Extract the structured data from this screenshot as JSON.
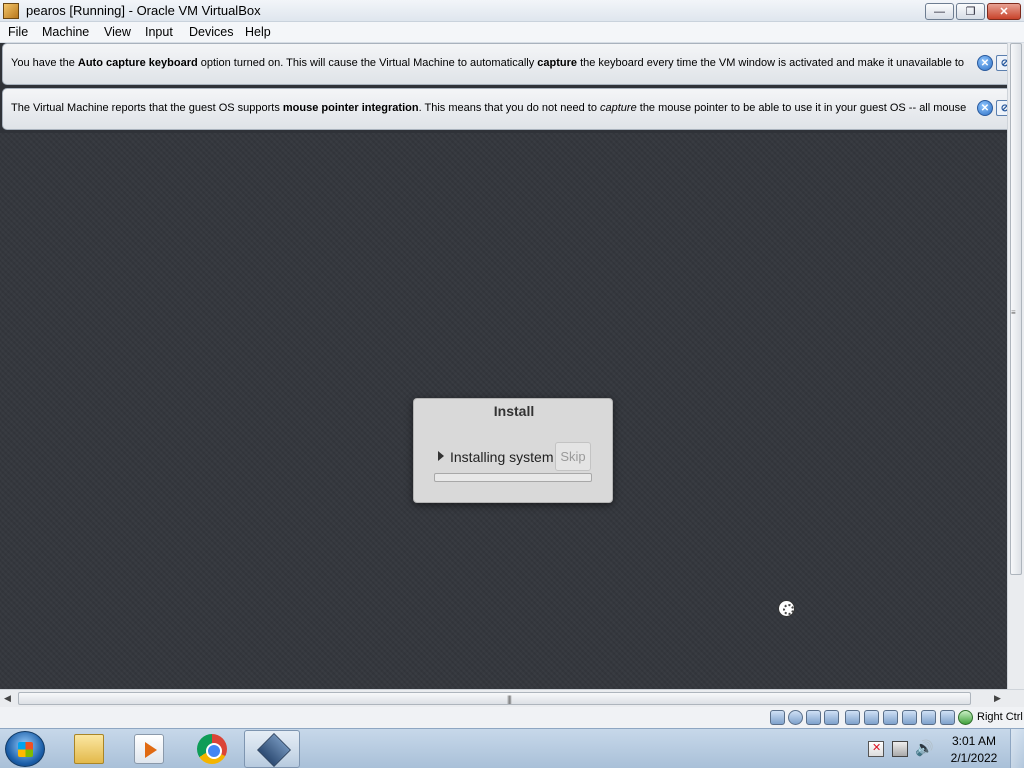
{
  "window": {
    "title": "pearos [Running] - Oracle VM VirtualBox",
    "minimize_label": "—",
    "maximize_label": "❐",
    "close_label": "✕"
  },
  "menubar": {
    "items": [
      {
        "label": "File"
      },
      {
        "label": "Machine"
      },
      {
        "label": "View"
      },
      {
        "label": "Input"
      },
      {
        "label": "Devices"
      },
      {
        "label": "Help"
      }
    ]
  },
  "popups": [
    {
      "segments": [
        {
          "text": "You have the ",
          "style": "normal"
        },
        {
          "text": "Auto capture keyboard",
          "style": "bold"
        },
        {
          "text": " option turned on. This will cause the Virtual Machine to automatically ",
          "style": "normal"
        },
        {
          "text": "capture",
          "style": "bold"
        },
        {
          "text": " the keyboard every time the VM window is activated and make it unavailable to",
          "style": "normal"
        }
      ]
    },
    {
      "segments": [
        {
          "text": "The Virtual Machine reports that the guest OS supports ",
          "style": "normal"
        },
        {
          "text": "mouse pointer integration",
          "style": "bold"
        },
        {
          "text": ". This means that you do not need to ",
          "style": "normal"
        },
        {
          "text": "capture",
          "style": "italic"
        },
        {
          "text": " the mouse pointer to be able to use it in your guest OS -- all mouse",
          "style": "normal"
        }
      ]
    }
  ],
  "install_dialog": {
    "title": "Install",
    "status": "Installing system",
    "skip_label": "Skip",
    "progress": 0.0
  },
  "statusbar": {
    "host_key": "Right Ctrl",
    "icons": [
      "hard-disk-icon",
      "optical-drive-icon",
      "audio-icon",
      "network-icon",
      "usb-icon",
      "shared-folders-icon",
      "display-icon",
      "video-capture-icon",
      "vm-status-icon",
      "cpu-icon",
      "mouse-integration-icon",
      "keyboard-icon"
    ]
  },
  "taskbar": {
    "apps": [
      {
        "name": "explorer",
        "icon": "folder-icon"
      },
      {
        "name": "media-player",
        "icon": "media-player-icon"
      },
      {
        "name": "chrome",
        "icon": "chrome-icon"
      },
      {
        "name": "virtualbox",
        "icon": "virtualbox-icon",
        "active": true
      }
    ],
    "clock": {
      "time": "3:01 AM",
      "date": "2/1/2022"
    }
  },
  "colors": {
    "vm_background": "#34373d",
    "dialog_background": "#d9d9d9",
    "taskbar": "#b9cce0"
  }
}
